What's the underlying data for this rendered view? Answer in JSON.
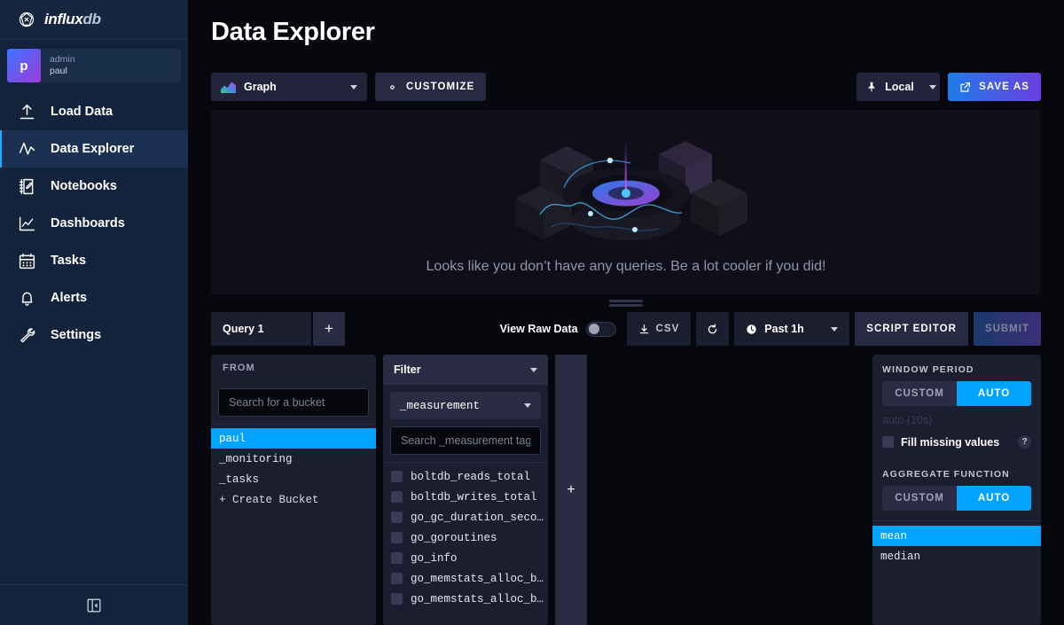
{
  "brand": {
    "name_bold": "influx",
    "name_light": "db",
    "logo_icon": "influxdb-logo-icon"
  },
  "user": {
    "initial": "p",
    "org": "admin",
    "name": "paul"
  },
  "sidebar": {
    "items": [
      {
        "label": "Load Data",
        "icon": "upload-icon",
        "active": false
      },
      {
        "label": "Data Explorer",
        "icon": "line-graph-icon",
        "active": true
      },
      {
        "label": "Notebooks",
        "icon": "notebook-pencil-icon",
        "active": false
      },
      {
        "label": "Dashboards",
        "icon": "dashboard-chart-icon",
        "active": false
      },
      {
        "label": "Tasks",
        "icon": "calendar-icon",
        "active": false
      },
      {
        "label": "Alerts",
        "icon": "bell-icon",
        "active": false
      },
      {
        "label": "Settings",
        "icon": "wrench-icon",
        "active": false
      }
    ],
    "collapse_icon": "collapse-panel-icon"
  },
  "header": {
    "title": "Data Explorer"
  },
  "toolbar": {
    "view_type": "Graph",
    "view_type_icon": "graph-swatch-icon",
    "customize_label": "CUSTOMIZE",
    "customize_icon": "gear-icon",
    "local_label": "Local",
    "local_icon": "pin-icon",
    "save_as_label": "SAVE AS",
    "save_as_icon": "export-icon"
  },
  "graph": {
    "empty_message": "Looks like you don’t have any queries. Be a lot cooler if you did!",
    "illustration": "data-explorer-empty-illustration"
  },
  "query_bar": {
    "tab_label": "Query 1",
    "add_query_label": "+",
    "raw_data_label": "View Raw Data",
    "raw_data_on": false,
    "csv_label": "CSV",
    "csv_icon": "download-icon",
    "refresh_icon": "refresh-icon",
    "time_range": "Past 1h",
    "time_icon": "clock-icon",
    "script_editor_label": "SCRIPT EDITOR",
    "submit_label": "SUBMIT"
  },
  "from_panel": {
    "title": "FROM",
    "search_placeholder": "Search for a bucket",
    "search_value": "",
    "buckets": [
      {
        "label": "paul",
        "selected": true
      },
      {
        "label": "_monitoring",
        "selected": false
      },
      {
        "label": "_tasks",
        "selected": false
      }
    ],
    "create_bucket_label": "+ Create Bucket"
  },
  "filter_panel": {
    "title": "Filter",
    "tag_key": "_measurement",
    "search_placeholder": "Search _measurement tag values",
    "search_value": "",
    "values": [
      "boltdb_reads_total",
      "boltdb_writes_total",
      "go_gc_duration_seco…",
      "go_goroutines",
      "go_info",
      "go_memstats_alloc_b…",
      "go_memstats_alloc_b…"
    ]
  },
  "add_column": {
    "label": "+"
  },
  "options_panel": {
    "window_period_label": "WINDOW PERIOD",
    "window_custom_label": "CUSTOM",
    "window_auto_label": "AUTO",
    "window_selected": "AUTO",
    "auto_note": "auto (10s)",
    "fill_missing_label": "Fill missing values",
    "fill_missing_checked": false,
    "help_icon": "question-mark-icon",
    "aggregate_label": "AGGREGATE FUNCTION",
    "aggregate_custom_label": "CUSTOM",
    "aggregate_auto_label": "AUTO",
    "aggregate_selected": "AUTO",
    "functions": [
      {
        "label": "mean",
        "selected": true
      },
      {
        "label": "median",
        "selected": false
      }
    ]
  },
  "colors": {
    "accent_blue": "#00a3ff",
    "sidebar_bg": "#13233c",
    "panel_bg": "#1c1d2e",
    "page_bg": "#07070e"
  }
}
